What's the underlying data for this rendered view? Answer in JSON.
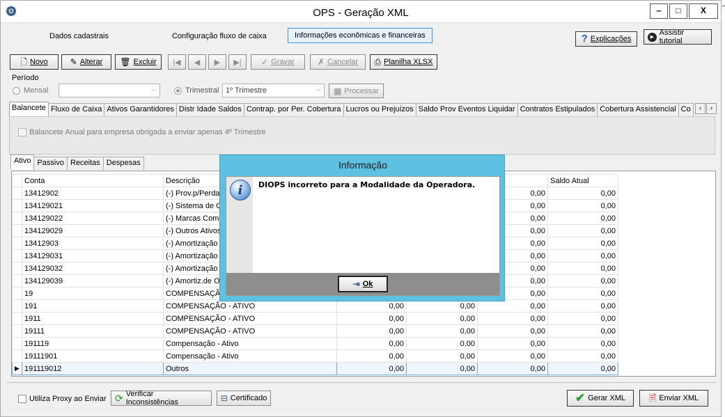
{
  "window": {
    "title": "OPS - Geração XML",
    "app_icon": "op-icon",
    "controls": [
      "‒",
      "□",
      "X"
    ]
  },
  "topnav": {
    "dados": "Dados cadastrais",
    "config": "Configuração fluxo de caixa",
    "info": "Informações econômicas e financeiras",
    "explicacoes": "Explicações",
    "tutorial": "Assistir tutorial"
  },
  "toolbar": {
    "novo": "Novo",
    "alterar": "Alterar",
    "excluir": "Excluir",
    "gravar": "Gravar",
    "cancelar": "Cancelar",
    "planilha": "Planilha XLSX",
    "nav": [
      "|◀",
      "◀",
      "▶",
      "▶|"
    ]
  },
  "periodo": {
    "label": "Período",
    "mensal": "Mensal",
    "mensal_value": "",
    "trimestral": "Trimestral",
    "trimestral_value": "1º Trimestre",
    "processar": "Processar"
  },
  "tabs": [
    "Balancete",
    "Fluxo de Caixa",
    "Ativos Garantidores",
    "Distr Idade Saldos",
    "Contrap. por Per. Cobertura",
    "Lucros ou Prejuízos",
    "Saldo Prov Eventos Liquidar",
    "Contratos Estipulados",
    "Cobertura Assistencial",
    "Co"
  ],
  "panel": {
    "balancete_anual": "Balancete Anual para empresa obrigada a enviar apenas 4º Trimestre"
  },
  "subtabs": [
    "Ativo",
    "Passivo",
    "Receitas",
    "Despesas"
  ],
  "grid": {
    "columns": [
      "Conta",
      "Descrição",
      "",
      "",
      "",
      "Saldo Atual"
    ],
    "rows": [
      [
        "13412902",
        "(-) Prov.p/Perda",
        "",
        "",
        "0,00",
        "0,00"
      ],
      [
        "134129021",
        "(-) Sistema de Co",
        "",
        "",
        "0,00",
        "0,00"
      ],
      [
        "134129022",
        "(-) Marcas Comer",
        "",
        "",
        "0,00",
        "0,00"
      ],
      [
        "134129029",
        "(-) Outros Ativos I",
        "",
        "",
        "0,00",
        "0,00"
      ],
      [
        "13412903",
        "(-) Amortização A",
        "",
        "",
        "0,00",
        "0,00"
      ],
      [
        "134129031",
        "(-) Amortização d",
        "",
        "",
        "0,00",
        "0,00"
      ],
      [
        "134129032",
        "(-) Amortização d",
        "",
        "",
        "0,00",
        "0,00"
      ],
      [
        "134129039",
        "(-) Amortiz.de Out",
        "",
        "",
        "0,00",
        "0,00"
      ],
      [
        "19",
        "COMPENSAÇÃ",
        "",
        "",
        "0,00",
        "0,00"
      ],
      [
        "191",
        "COMPENSAÇÃO - ATIVO",
        "0,00",
        "0,00",
        "0,00",
        "0,00"
      ],
      [
        "1911",
        "COMPENSAÇÃO - ATIVO",
        "0,00",
        "0,00",
        "0,00",
        "0,00"
      ],
      [
        "19111",
        "COMPENSAÇÃO - ATIVO",
        "0,00",
        "0,00",
        "0,00",
        "0,00"
      ],
      [
        "191119",
        "Compensação - Ativo",
        "0,00",
        "0,00",
        "0,00",
        "0,00"
      ],
      [
        "19111901",
        "Compensação - Ativo",
        "0,00",
        "0,00",
        "0,00",
        "0,00"
      ],
      [
        "191119012",
        "Outros",
        "0,00",
        "0,00",
        "0,00",
        "0,00"
      ]
    ],
    "selected_row": 14
  },
  "bottom": {
    "proxy": "Utiliza Proxy ao Enviar",
    "verificar": "Verificar Inconsistências",
    "certificado": "Certificado",
    "gerar": "Gerar XML",
    "enviar": "Enviar XML"
  },
  "dialog": {
    "title": "Informação",
    "message": "DIOPS incorreto para a Modalidade da Operadora.",
    "ok": "Ok",
    "icon": "info-icon"
  },
  "colors": {
    "dialog_frame": "#5fc1e2",
    "selection": "#3c97dd",
    "gerar_icon": "#2e9b2e",
    "enviar_icon": "#c0282d"
  }
}
